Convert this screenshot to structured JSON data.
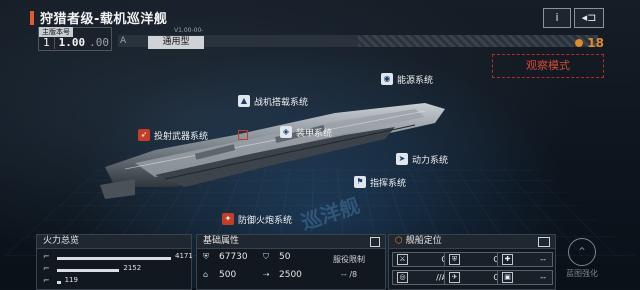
{
  "header": {
    "title": "狩猎者级-载机巡洋舰",
    "info_button": "i",
    "back_button": "◂⊐"
  },
  "version": {
    "tag": "主版本号",
    "number_prefix": "1",
    "number": "1.00",
    "number_suffix": ".00",
    "sub_label": "V1.00-00-",
    "grade_letter": "A",
    "grade_name": "通用型"
  },
  "currency": {
    "value": "18",
    "color": "#e08a2a"
  },
  "observe_mode": "观察模式",
  "watermark": "巡洋舰",
  "systems": [
    {
      "label": "能源系统",
      "icon": "energy-icon"
    },
    {
      "label": "战机搭载系统",
      "icon": "fighter-icon"
    },
    {
      "label": "投射武器系统",
      "icon": "missile-icon",
      "alert": true
    },
    {
      "label": "装甲系统",
      "icon": "armor-icon"
    },
    {
      "label": "动力系统",
      "icon": "engine-icon"
    },
    {
      "label": "指挥系统",
      "icon": "command-icon"
    },
    {
      "label": "防御火炮系统",
      "icon": "defense-gun-icon",
      "alert": true
    }
  ],
  "firepower": {
    "title": "火力总览",
    "rows": [
      {
        "icon": "gun-icon",
        "value": 4171,
        "fraction": 0.95
      },
      {
        "icon": "gun-icon",
        "value": 2152,
        "fraction": 0.52
      },
      {
        "icon": "gun-icon",
        "value": 119,
        "fraction": 0.03
      }
    ]
  },
  "attributes": {
    "title": "基础属性",
    "items": [
      {
        "icon": "hull-icon",
        "value": "67730"
      },
      {
        "icon": "shield-icon",
        "value": "50"
      },
      {
        "icon": "cost-icon",
        "value": "500"
      },
      {
        "icon": "speed-icon",
        "value": "2500"
      }
    ],
    "limit_label": "服役限制",
    "limit_value": "-- /8"
  },
  "positioning": {
    "title": "舰船定位",
    "cells": [
      {
        "icon": "attack-icon",
        "value": "C"
      },
      {
        "icon": "defense-icon",
        "value": "C"
      },
      {
        "icon": "support-icon",
        "value": "//A"
      },
      {
        "icon": "scout-icon",
        "value": "C"
      },
      {
        "icon": "antiair-icon",
        "value": "C"
      },
      {
        "icon": "carrier-icon",
        "value": "C"
      }
    ]
  },
  "enhance": {
    "label": "蓝图强化"
  }
}
